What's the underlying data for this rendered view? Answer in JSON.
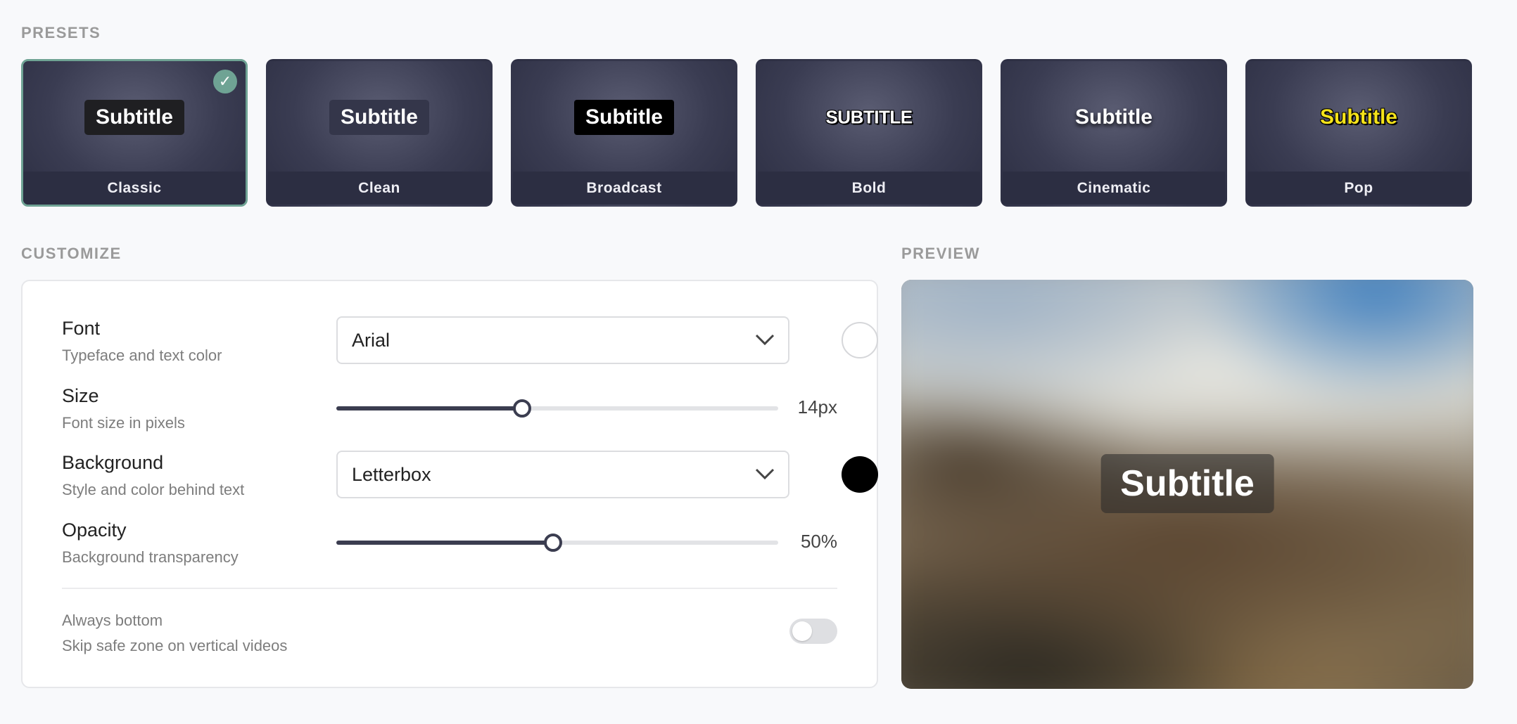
{
  "sections": {
    "presets": "PRESETS",
    "customize": "CUSTOMIZE",
    "preview": "PREVIEW"
  },
  "presets": [
    {
      "name": "Classic",
      "sample": "Subtitle",
      "selected": true
    },
    {
      "name": "Clean",
      "sample": "Subtitle",
      "selected": false
    },
    {
      "name": "Broadcast",
      "sample": "Subtitle",
      "selected": false
    },
    {
      "name": "Bold",
      "sample": "SUBTITLE",
      "selected": false
    },
    {
      "name": "Cinematic",
      "sample": "Subtitle",
      "selected": false
    },
    {
      "name": "Pop",
      "sample": "Subtitle",
      "selected": false
    }
  ],
  "customize": {
    "font": {
      "label": "Font",
      "desc": "Typeface and text color",
      "value": "Arial",
      "color": "#ffffff"
    },
    "size": {
      "label": "Size",
      "desc": "Font size in pixels",
      "value": "14px",
      "fraction": 0.42
    },
    "background": {
      "label": "Background",
      "desc": "Style and color behind text",
      "value": "Letterbox",
      "color": "#000000"
    },
    "opacity": {
      "label": "Opacity",
      "desc": "Background transparency",
      "value": "50%",
      "fraction": 0.49
    },
    "always_bottom": {
      "label": "Always bottom",
      "desc": "Skip safe zone on vertical videos",
      "enabled": false
    }
  },
  "preview": {
    "caption": "Subtitle"
  },
  "colors": {
    "accent": "#6fa394",
    "slider": "#3b3d50"
  }
}
